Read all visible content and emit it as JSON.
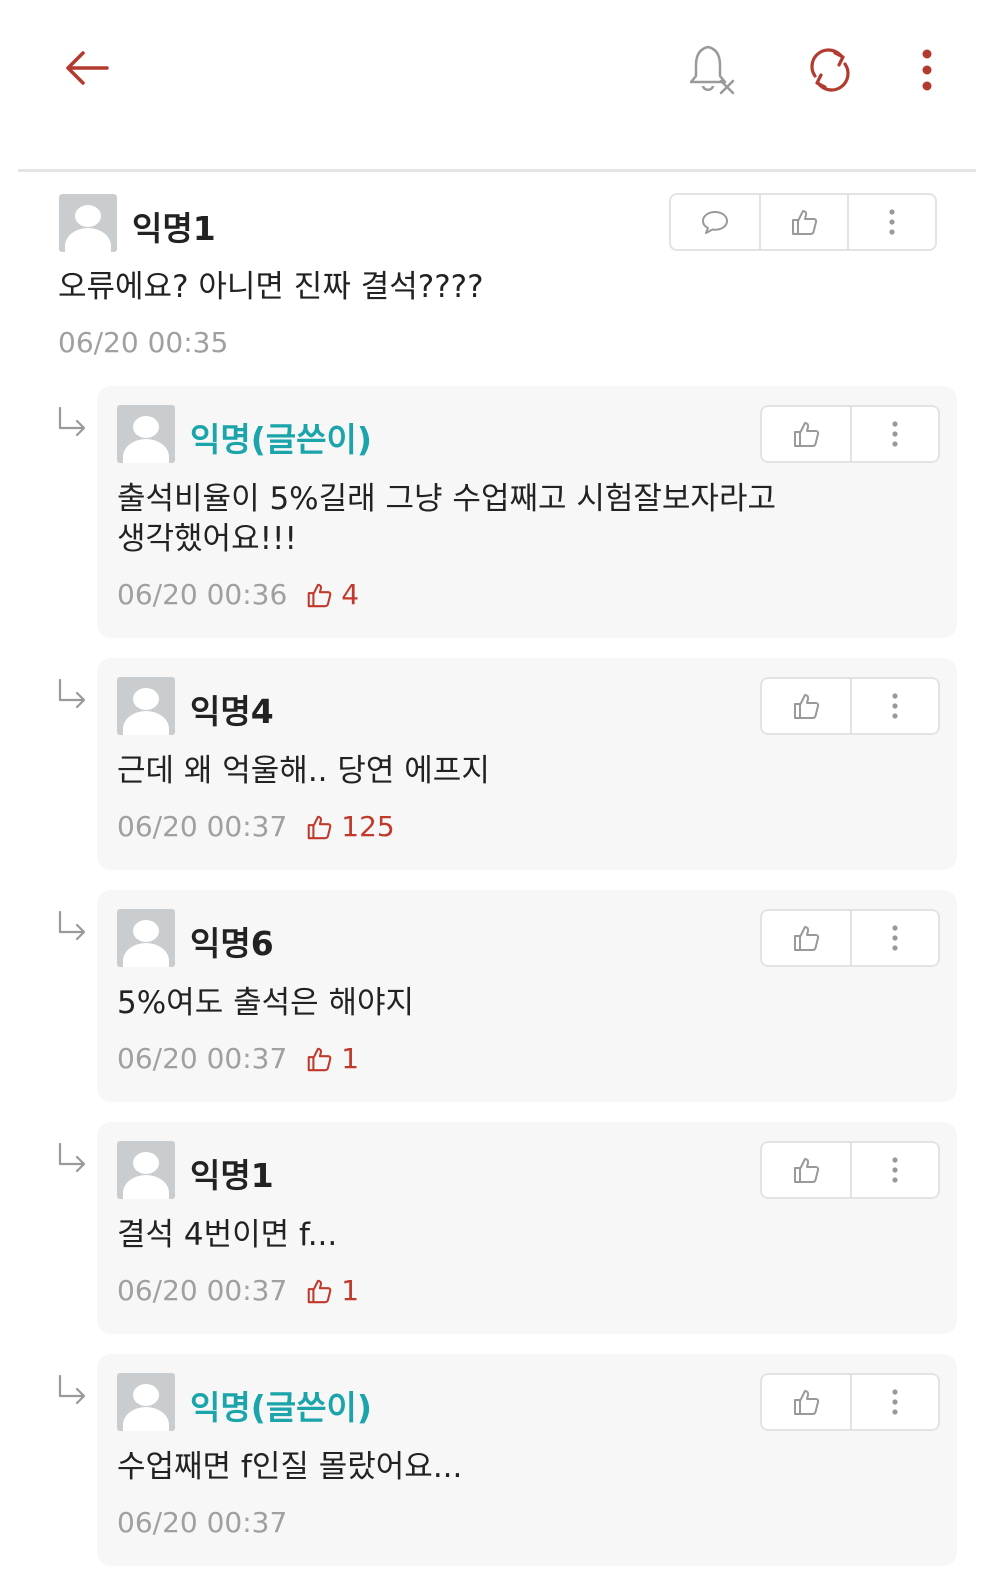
{
  "colors": {
    "accent": "#b23a2e",
    "author": "#1ba5ab",
    "meta": "#a0a0a0",
    "like": "#c0392b"
  },
  "topbar": {
    "icons": [
      "back-arrow-icon",
      "bell-off-icon",
      "refresh-icon",
      "more-vertical-icon"
    ]
  },
  "main_comment": {
    "name": "익명1",
    "text": "오류에요? 아니면 진짜 결석????",
    "time": "06/20 00:35"
  },
  "replies": [
    {
      "name": "익명(글쓴이)",
      "is_author": true,
      "lines": [
        "출석비율이 5%길래 그냥 수업째고 시험잘보자라고",
        "생각했어요!!!"
      ],
      "time": "06/20 00:36",
      "likes": "4"
    },
    {
      "name": "익명4",
      "is_author": false,
      "lines": [
        "근데 왜 억울해.. 당연 에프지"
      ],
      "time": "06/20 00:37",
      "likes": "125"
    },
    {
      "name": "익명6",
      "is_author": false,
      "lines": [
        "5%여도 출석은 해야지"
      ],
      "time": "06/20 00:37",
      "likes": "1"
    },
    {
      "name": "익명1",
      "is_author": false,
      "lines": [
        "결석 4번이면 f..."
      ],
      "time": "06/20 00:37",
      "likes": "1"
    },
    {
      "name": "익명(글쓴이)",
      "is_author": true,
      "lines": [
        "수업째면 f인질 몰랐어요..."
      ],
      "time": "06/20 00:37",
      "likes": ""
    }
  ]
}
